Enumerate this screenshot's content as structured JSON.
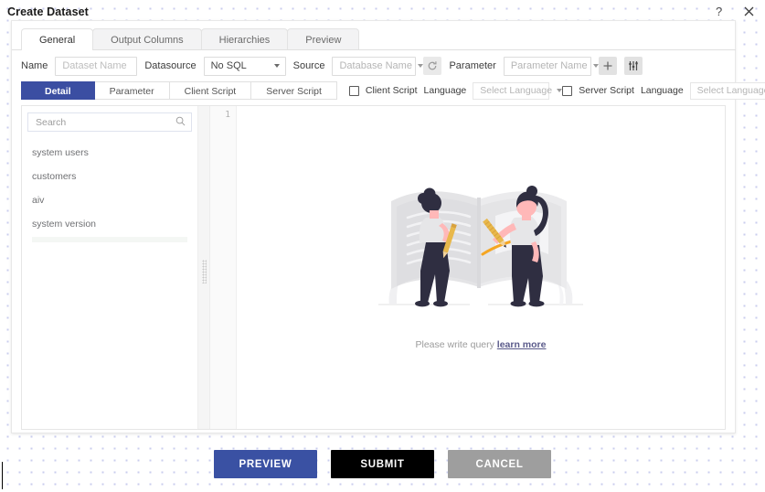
{
  "window": {
    "title": "Create Dataset",
    "help_icon": "question-mark-icon",
    "close_icon": "close-icon"
  },
  "tabs": [
    {
      "label": "General",
      "active": true
    },
    {
      "label": "Output Columns",
      "active": false
    },
    {
      "label": "Hierarchies",
      "active": false
    },
    {
      "label": "Preview",
      "active": false
    }
  ],
  "form": {
    "name_label": "Name",
    "name_placeholder": "Dataset Name",
    "name_value": "",
    "datasource_label": "Datasource",
    "datasource_value": "No SQL",
    "refresh_icon": "refresh-icon",
    "source_label": "Source",
    "source_value": "Database Name",
    "parameter_label": "Parameter",
    "parameter_value": "Parameter Name",
    "add_icon": "plus-icon",
    "settings_icon": "sliders-icon"
  },
  "subtabs": [
    {
      "label": "Detail",
      "active": true
    },
    {
      "label": "Parameter",
      "active": false
    },
    {
      "label": "Client Script",
      "active": false
    },
    {
      "label": "Server Script",
      "active": false
    }
  ],
  "script_options": {
    "client_script_label": "Client Script",
    "client_script_checked": false,
    "client_language_label": "Language",
    "client_language_value": "Select Language",
    "server_script_label": "Server Script",
    "server_script_checked": false,
    "server_language_label": "Language",
    "server_language_value": "Select Language"
  },
  "sidebar": {
    "search_placeholder": "Search",
    "search_value": "",
    "search_icon": "search-icon",
    "items": [
      {
        "label": "system users"
      },
      {
        "label": "customers"
      },
      {
        "label": "aiv"
      },
      {
        "label": "system version"
      }
    ]
  },
  "editor": {
    "line_numbers": "1",
    "content": "",
    "empty_message": "Please write query",
    "empty_link": "learn more"
  },
  "footer": {
    "preview_label": "PREVIEW",
    "submit_label": "SUBMIT",
    "cancel_label": "CANCEL"
  },
  "colors": {
    "accent_blue": "#3a51a3",
    "submit_black": "#000000",
    "cancel_gray": "#9e9e9e",
    "dot_pattern": "#c9cdee",
    "illustration_gray": "#e4e4e6",
    "illustration_dark": "#2f2e41",
    "illustration_orange": "#f5a623",
    "illustration_skin": "#ffb8b8"
  }
}
